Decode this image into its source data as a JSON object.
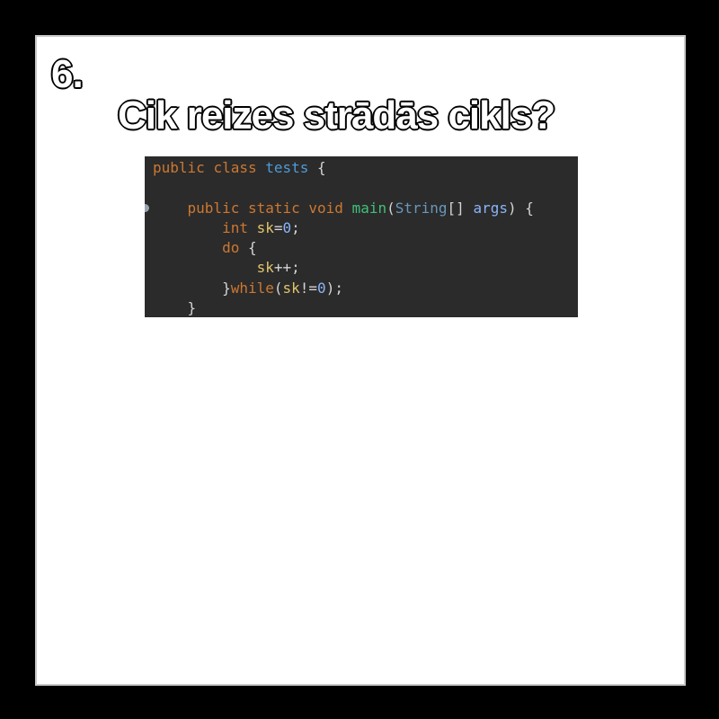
{
  "slide": {
    "number": "6.",
    "title": "Cik reizes strādās cikls?"
  },
  "code": {
    "language": "java",
    "lines": [
      "public class tests {",
      "",
      "    public static void main(String[] args) {",
      "        int sk=0;",
      "        do {",
      "            sk++;",
      "        }while(sk!=0);",
      "    }"
    ],
    "tokens": {
      "l1_public": "public",
      "l1_class": "class",
      "l1_name": "tests",
      "l1_brace": " {",
      "l3_public": "public",
      "l3_static": "static",
      "l3_void": "void",
      "l3_main": "main",
      "l3_open": "(",
      "l3_string": "String",
      "l3_brackets": "[]",
      "l3_args": "args",
      "l3_close": ") {",
      "l4_int": "int",
      "l4_sk": "sk",
      "l4_eq": "=",
      "l4_zero": "0",
      "l4_semi": ";",
      "l5_do": "do",
      "l5_brace": " {",
      "l6_sk": "sk",
      "l6_inc": "++;",
      "l7_close": "}",
      "l7_while": "while",
      "l7_open": "(",
      "l7_sk": "sk",
      "l7_ne": "!=",
      "l7_zero": "0",
      "l7_end": ");",
      "l8_close": "}"
    }
  },
  "colors": {
    "background": "#000000",
    "slide": "#ffffff",
    "code_background": "#2b2b2b",
    "keyword": "#cc7832",
    "class_name": "#4e9bd6",
    "method": "#41c07a",
    "variable": "#e0c46c"
  },
  "icons": {
    "gutter_marker": "breakpoint-dot-icon"
  }
}
